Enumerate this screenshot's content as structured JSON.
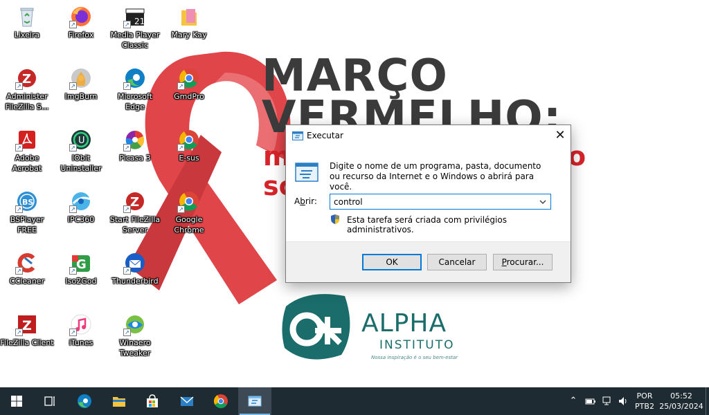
{
  "wallpaper": {
    "headline_line1": "MARÇO",
    "headline_line2": "VERMELHO:",
    "sub_line1": "m",
    "sub_line1_tail": "o",
    "sub_line2": "sc",
    "logo_name": "ALPHA",
    "logo_sub": "INSTITUTO",
    "logo_tagline": "Nossa inspiração é o seu bem-estar",
    "ribbon_color": "#e0454a"
  },
  "desktop_icons": [
    {
      "label": "Lixeira",
      "icon": "recycle-bin-icon"
    },
    {
      "label": "Firefox",
      "icon": "firefox-icon"
    },
    {
      "label": "Media Player Classic",
      "icon": "media-player-icon"
    },
    {
      "label": "Mary Kay",
      "icon": "folder-icon"
    },
    {
      "label": "Administer FileZilla S...",
      "icon": "filezilla-server-icon"
    },
    {
      "label": "ImgBurn",
      "icon": "imgburn-icon"
    },
    {
      "label": "Microsoft Edge",
      "icon": "edge-icon"
    },
    {
      "label": "GmdPro",
      "icon": "chrome-icon"
    },
    {
      "label": "Adobe Acrobat",
      "icon": "acrobat-icon"
    },
    {
      "label": "IObit Uninstaller",
      "icon": "iobit-icon"
    },
    {
      "label": "Picasa 3",
      "icon": "picasa-icon"
    },
    {
      "label": "E-sus",
      "icon": "chrome-icon"
    },
    {
      "label": "BSPlayer FREE",
      "icon": "bsplayer-icon"
    },
    {
      "label": "IPC360",
      "icon": "ipc360-icon"
    },
    {
      "label": "Start FileZilla Server",
      "icon": "filezilla-server-icon"
    },
    {
      "label": "Google Chrome",
      "icon": "chrome-icon"
    },
    {
      "label": "CCleaner",
      "icon": "ccleaner-icon"
    },
    {
      "label": "Iso2God",
      "icon": "iso2god-icon"
    },
    {
      "label": "Thunderbird",
      "icon": "thunderbird-icon"
    },
    {
      "label": "FileZilla Client",
      "icon": "filezilla-client-icon"
    },
    {
      "label": "iTunes",
      "icon": "itunes-icon"
    },
    {
      "label": "Winaero Tweaker",
      "icon": "winaero-icon"
    }
  ],
  "run_dialog": {
    "title": "Executar",
    "description": "Digite o nome de um programa, pasta, documento ou recurso da Internet e o Windows o abrirá para você.",
    "open_label_prefix": "A",
    "open_label_underlined": "b",
    "open_label_suffix": "rir:",
    "input_value": "control",
    "admin_note": "Esta tarefa será criada com privilégios administrativos.",
    "ok_label": "OK",
    "cancel_label": "Cancelar",
    "browse_label_underlined": "P",
    "browse_label_rest": "rocurar...",
    "accent_color": "#0078d7"
  },
  "taskbar": {
    "items": [
      {
        "icon": "windows-start-icon"
      },
      {
        "icon": "task-view-icon"
      },
      {
        "icon": "edge-icon"
      },
      {
        "icon": "file-explorer-icon"
      },
      {
        "icon": "store-icon"
      },
      {
        "icon": "mail-icon"
      },
      {
        "icon": "chrome-icon"
      },
      {
        "icon": "run-icon",
        "active": true
      }
    ],
    "language": "POR",
    "keyboard": "PTB2",
    "time": "05:52",
    "date": "25/03/2024"
  }
}
